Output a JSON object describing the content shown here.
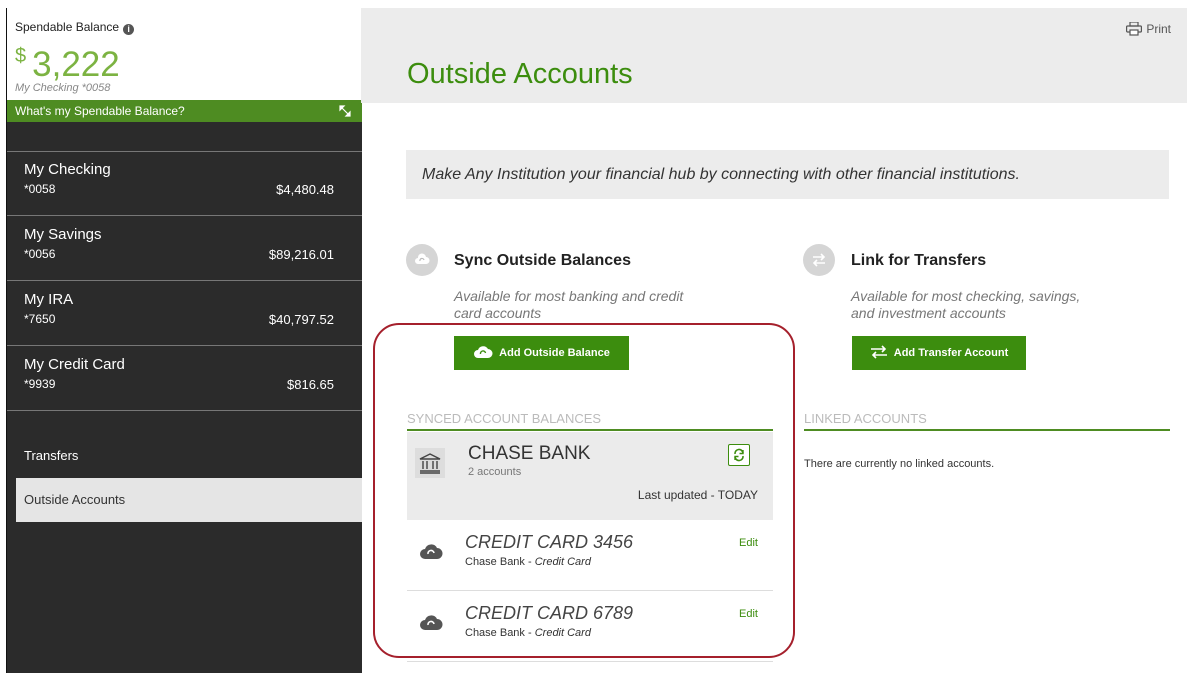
{
  "spendable": {
    "label": "Spendable Balance",
    "currency_symbol": "$",
    "amount": "3,222",
    "sub": "My Checking *0058",
    "whats_label": "What's my Spendable Balance?"
  },
  "accounts": [
    {
      "name": "My Checking",
      "number": "*0058",
      "balance": "$4,480.48"
    },
    {
      "name": "My Savings",
      "number": "*0056",
      "balance": "$89,216.01"
    },
    {
      "name": "My IRA",
      "number": "*7650",
      "balance": "$40,797.52"
    },
    {
      "name": "My Credit Card",
      "number": "*9939",
      "balance": "$816.65"
    }
  ],
  "nav": {
    "transfers": "Transfers",
    "outside_accounts": "Outside Accounts"
  },
  "header": {
    "title": "Outside Accounts",
    "print_label": "Print"
  },
  "banner": "Make Any Institution your financial hub by connecting with other financial institutions.",
  "sync": {
    "title": "Sync Outside Balances",
    "description_line1": "Available for most banking and credit",
    "description_line2": "card accounts",
    "button_label": "Add Outside Balance",
    "list_heading": "SYNCED ACCOUNT BALANCES"
  },
  "link": {
    "title": "Link for Transfers",
    "description_line1": "Available for most checking, savings,",
    "description_line2": "and investment accounts",
    "button_label": "Add Transfer Account",
    "list_heading": "LINKED ACCOUNTS",
    "empty_text": "There are currently no linked accounts."
  },
  "bank": {
    "name": "CHASE BANK",
    "count": "2 accounts",
    "updated": "Last updated - TODAY"
  },
  "synced_cards": [
    {
      "name": "CREDIT CARD 3456",
      "bank": "Chase Bank",
      "type": "Credit Card",
      "edit": "Edit"
    },
    {
      "name": "CREDIT CARD 6789",
      "bank": "Chase Bank",
      "type": "Credit Card",
      "edit": "Edit"
    }
  ],
  "colors": {
    "brand_green": "#3c8d0e",
    "balance_green": "#7cb342",
    "highlight_red": "#a5202c",
    "sidebar_bg": "#2b2b2b"
  },
  "icons": [
    "info-icon",
    "expand-icon",
    "print-icon",
    "cloud-sync-icon",
    "transfer-arrows-icon",
    "bank-icon",
    "refresh-icon"
  ]
}
